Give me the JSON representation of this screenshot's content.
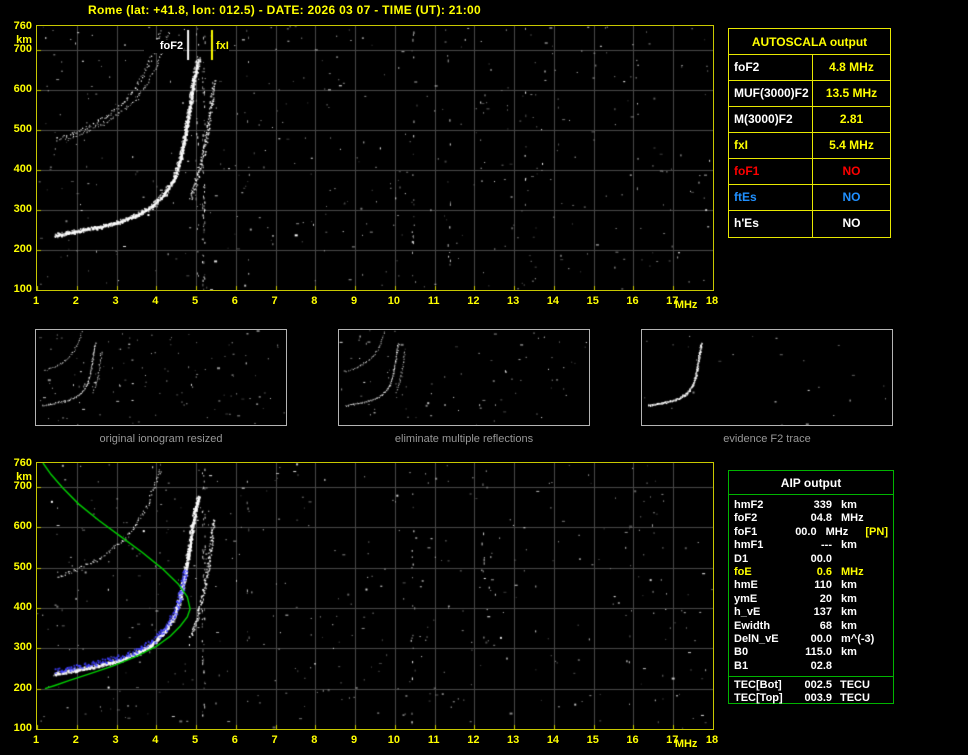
{
  "title": "Rome (lat: +41.8, lon: 012.5) - DATE: 2026 03 07 - TIME (UT): 21:00",
  "colors": {
    "accent_yellow": "#ffff00",
    "accent_green": "#00c000",
    "grid": "#484848",
    "trace_white": "#ffffff",
    "restored_blue": "#4040ff",
    "profile_green": "#00d000"
  },
  "ionogram": {
    "x_unit": "MHz",
    "y_unit": "km",
    "y_top_label": "760",
    "x_ticks": [
      "1",
      "2",
      "3",
      "4",
      "5",
      "6",
      "7",
      "8",
      "9",
      "10",
      "11",
      "12",
      "13",
      "14",
      "15",
      "16",
      "17",
      "18"
    ],
    "y_ticks": [
      "700",
      "600",
      "500",
      "400",
      "300",
      "200",
      "100"
    ],
    "f_min": 1,
    "f_max": 18,
    "km_min": 100,
    "km_max": 760,
    "markers": [
      {
        "id": "foF2",
        "label": "foF2",
        "freq_mhz": 4.8,
        "color": "#ffffff",
        "label_side": "left"
      },
      {
        "id": "fxI",
        "label": "fxI",
        "freq_mhz": 5.4,
        "color": "#ffff00",
        "label_side": "right"
      }
    ],
    "traces": {
      "f2_first_hop": [
        [
          1.45,
          238
        ],
        [
          2.0,
          248
        ],
        [
          2.5,
          258
        ],
        [
          3.0,
          270
        ],
        [
          3.5,
          288
        ],
        [
          3.9,
          312
        ],
        [
          4.2,
          342
        ],
        [
          4.45,
          382
        ],
        [
          4.6,
          430
        ],
        [
          4.72,
          490
        ],
        [
          4.82,
          550
        ],
        [
          4.9,
          605
        ],
        [
          4.98,
          650
        ],
        [
          5.05,
          680
        ]
      ],
      "f2_x_mode": [
        [
          4.85,
          330
        ],
        [
          5.05,
          390
        ],
        [
          5.2,
          450
        ],
        [
          5.3,
          510
        ],
        [
          5.38,
          570
        ],
        [
          5.44,
          625
        ]
      ],
      "f2_second_hop": [
        [
          1.5,
          478
        ],
        [
          2.0,
          496
        ],
        [
          2.4,
          515
        ],
        [
          2.8,
          540
        ],
        [
          3.2,
          572
        ],
        [
          3.5,
          610
        ],
        [
          3.75,
          655
        ],
        [
          3.95,
          705
        ],
        [
          4.1,
          750
        ]
      ],
      "profile": [
        [
          1.2,
          200
        ],
        [
          1.45,
          208
        ],
        [
          1.8,
          220
        ],
        [
          2.3,
          236
        ],
        [
          2.9,
          256
        ],
        [
          3.5,
          280
        ],
        [
          4.0,
          305
        ],
        [
          4.35,
          330
        ],
        [
          4.6,
          355
        ],
        [
          4.78,
          378
        ],
        [
          4.85,
          398
        ],
        [
          4.78,
          428
        ],
        [
          4.55,
          460
        ],
        [
          4.15,
          498
        ],
        [
          3.65,
          538
        ],
        [
          3.1,
          578
        ],
        [
          2.55,
          618
        ],
        [
          2.05,
          658
        ],
        [
          1.65,
          698
        ],
        [
          1.35,
          732
        ],
        [
          1.15,
          760
        ]
      ]
    }
  },
  "autoscala": {
    "header": "AUTOSCALA output",
    "rows": [
      {
        "label": "foF2",
        "value": "4.8 MHz",
        "label_color": "#ffffff",
        "value_color": "#ffff00"
      },
      {
        "label": "MUF(3000)F2",
        "value": "13.5 MHz",
        "label_color": "#ffffff",
        "value_color": "#ffff00"
      },
      {
        "label": "M(3000)F2",
        "value": "2.81",
        "label_color": "#ffffff",
        "value_color": "#ffff00"
      },
      {
        "label": "fxI",
        "value": "5.4 MHz",
        "label_color": "#ffff00",
        "value_color": "#ffff00"
      },
      {
        "label": "foF1",
        "value": "NO",
        "label_color": "#ff0000",
        "value_color": "#ff0000"
      },
      {
        "label": "ftEs",
        "value": "NO",
        "label_color": "#2090ff",
        "value_color": "#2090ff"
      },
      {
        "label": "h'Es",
        "value": "NO",
        "label_color": "#ffffff",
        "value_color": "#ffffff"
      }
    ]
  },
  "panels": [
    {
      "caption": "original ionogram resized"
    },
    {
      "caption": "eliminate multiple reflections"
    },
    {
      "caption": "evidence F2 trace"
    }
  ],
  "aip": {
    "header": "AIP output",
    "rows": [
      {
        "name": "hmF2",
        "value": "339",
        "unit": "km",
        "extra": "",
        "color": "#ffffff"
      },
      {
        "name": "foF2",
        "value": "04.8",
        "unit": "MHz",
        "extra": "",
        "color": "#ffffff"
      },
      {
        "name": "foF1",
        "value": "00.0",
        "unit": "MHz",
        "extra": "[PN]",
        "color": "#ffffff",
        "extra_color": "#ffff00"
      },
      {
        "name": "hmF1",
        "value": "---",
        "unit": "km",
        "extra": "",
        "color": "#ffffff"
      },
      {
        "name": "D1",
        "value": "00.0",
        "unit": "",
        "extra": "",
        "color": "#ffffff"
      },
      {
        "name": "foE",
        "value": "0.6",
        "unit": "MHz",
        "extra": "",
        "color": "#ffff00"
      },
      {
        "name": "hmE",
        "value": "110",
        "unit": "km",
        "extra": "",
        "color": "#ffffff"
      },
      {
        "name": "ymE",
        "value": "20",
        "unit": "km",
        "extra": "",
        "color": "#ffffff"
      },
      {
        "name": "h_vE",
        "value": "137",
        "unit": "km",
        "extra": "",
        "color": "#ffffff"
      },
      {
        "name": "Ewidth",
        "value": "68",
        "unit": "km",
        "extra": "",
        "color": "#ffffff"
      },
      {
        "name": "DelN_vE",
        "value": "00.0",
        "unit": "m^(-3)",
        "extra": "",
        "color": "#ffffff"
      },
      {
        "name": "B0",
        "value": "115.0",
        "unit": "km",
        "extra": "",
        "color": "#ffffff"
      },
      {
        "name": "B1",
        "value": "02.8",
        "unit": "",
        "extra": "",
        "color": "#ffffff"
      }
    ],
    "tec_rows": [
      {
        "name": "TEC[Bot]",
        "value": "002.5",
        "unit": "TECU"
      },
      {
        "name": "TEC[Top]",
        "value": "003.9",
        "unit": "TECU"
      }
    ]
  }
}
